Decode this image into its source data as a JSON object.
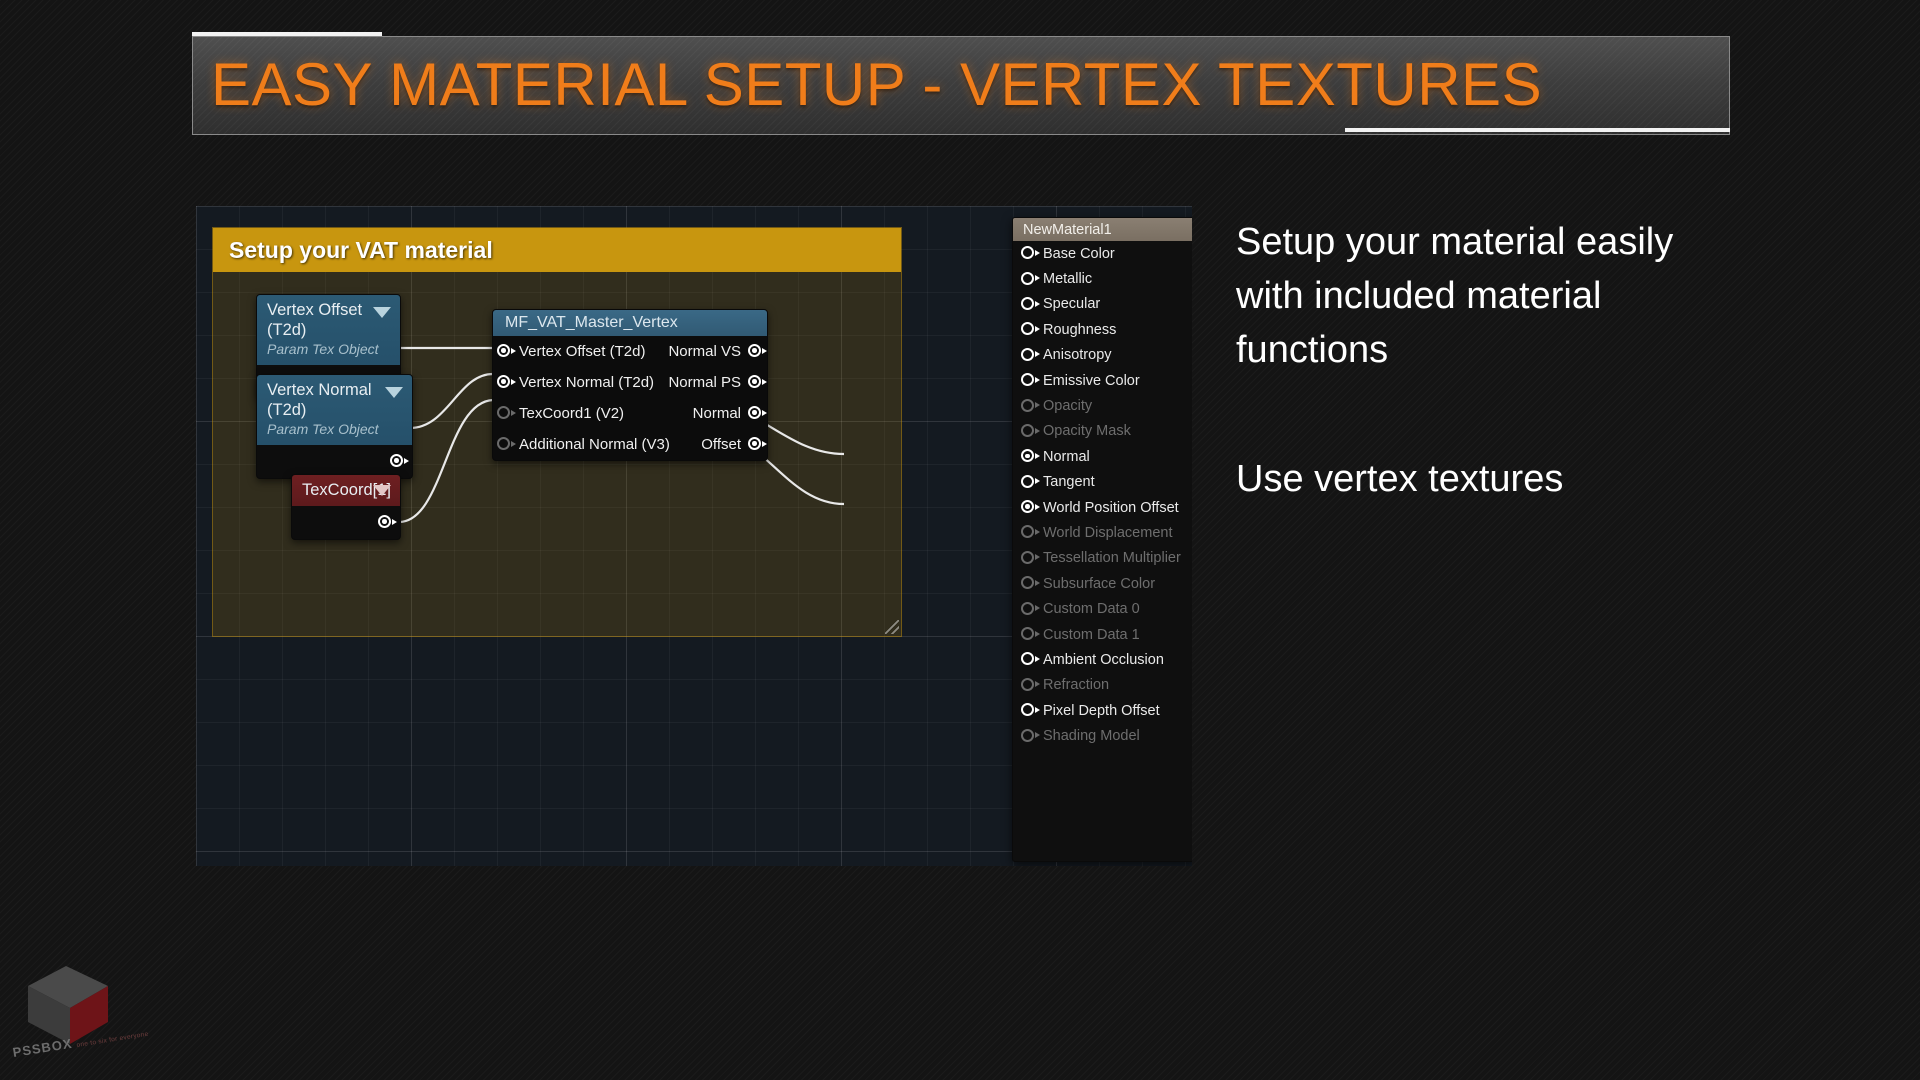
{
  "slide": {
    "title": "EASY MATERIAL SETUP - VERTEX TEXTURES",
    "title_color": "#f07d1a"
  },
  "graph": {
    "comment": {
      "title": "Setup your VAT material",
      "color": "#c8960f"
    },
    "nodes": {
      "vertex_offset": {
        "title": "Vertex Offset (T2d)",
        "subtitle": "Param Tex Object",
        "header_color": "#2c5a74"
      },
      "vertex_normal": {
        "title": "Vertex Normal (T2d)",
        "subtitle": "Param Tex Object",
        "header_color": "#2c5a74"
      },
      "texcoord": {
        "title": "TexCoord[1]",
        "header_color": "#6e1f21"
      },
      "material_function": {
        "title": "MF_VAT_Master_Vertex",
        "header_color": "#3a6986",
        "rows": [
          {
            "input": "Vertex Offset (T2d)",
            "input_connected": true,
            "output": "Normal VS",
            "output_connected": true
          },
          {
            "input": "Vertex Normal (T2d)",
            "input_connected": true,
            "output": "Normal PS",
            "output_connected": true
          },
          {
            "input": "TexCoord1 (V2)",
            "input_connected": false,
            "output": "Normal",
            "output_connected": true
          },
          {
            "input": "Additional Normal (V3)",
            "input_connected": false,
            "output": "Offset",
            "output_connected": true
          }
        ]
      },
      "material_output": {
        "title": "NewMaterial1",
        "header_color": "#8a7f72",
        "pins": [
          {
            "label": "Base Color",
            "enabled": true,
            "connected": false
          },
          {
            "label": "Metallic",
            "enabled": true,
            "connected": false
          },
          {
            "label": "Specular",
            "enabled": true,
            "connected": false
          },
          {
            "label": "Roughness",
            "enabled": true,
            "connected": false
          },
          {
            "label": "Anisotropy",
            "enabled": true,
            "connected": false
          },
          {
            "label": "Emissive Color",
            "enabled": true,
            "connected": false
          },
          {
            "label": "Opacity",
            "enabled": false,
            "connected": false
          },
          {
            "label": "Opacity Mask",
            "enabled": false,
            "connected": false
          },
          {
            "label": "Normal",
            "enabled": true,
            "connected": true
          },
          {
            "label": "Tangent",
            "enabled": true,
            "connected": false
          },
          {
            "label": "World Position Offset",
            "enabled": true,
            "connected": true
          },
          {
            "label": "World Displacement",
            "enabled": false,
            "connected": false
          },
          {
            "label": "Tessellation Multiplier",
            "enabled": false,
            "connected": false
          },
          {
            "label": "Subsurface Color",
            "enabled": false,
            "connected": false
          },
          {
            "label": "Custom Data 0",
            "enabled": false,
            "connected": false
          },
          {
            "label": "Custom Data 1",
            "enabled": false,
            "connected": false
          },
          {
            "label": "Ambient Occlusion",
            "enabled": true,
            "connected": false
          },
          {
            "label": "Refraction",
            "enabled": false,
            "connected": false
          },
          {
            "label": "Pixel Depth Offset",
            "enabled": true,
            "connected": false
          },
          {
            "label": "Shading Model",
            "enabled": false,
            "connected": false
          }
        ]
      }
    }
  },
  "callouts": {
    "primary": "Setup your material easily with included material functions",
    "secondary": "Use vertex textures"
  },
  "watermark": {
    "brand": "PSSBOX",
    "tagline": "one to six for everyone"
  }
}
